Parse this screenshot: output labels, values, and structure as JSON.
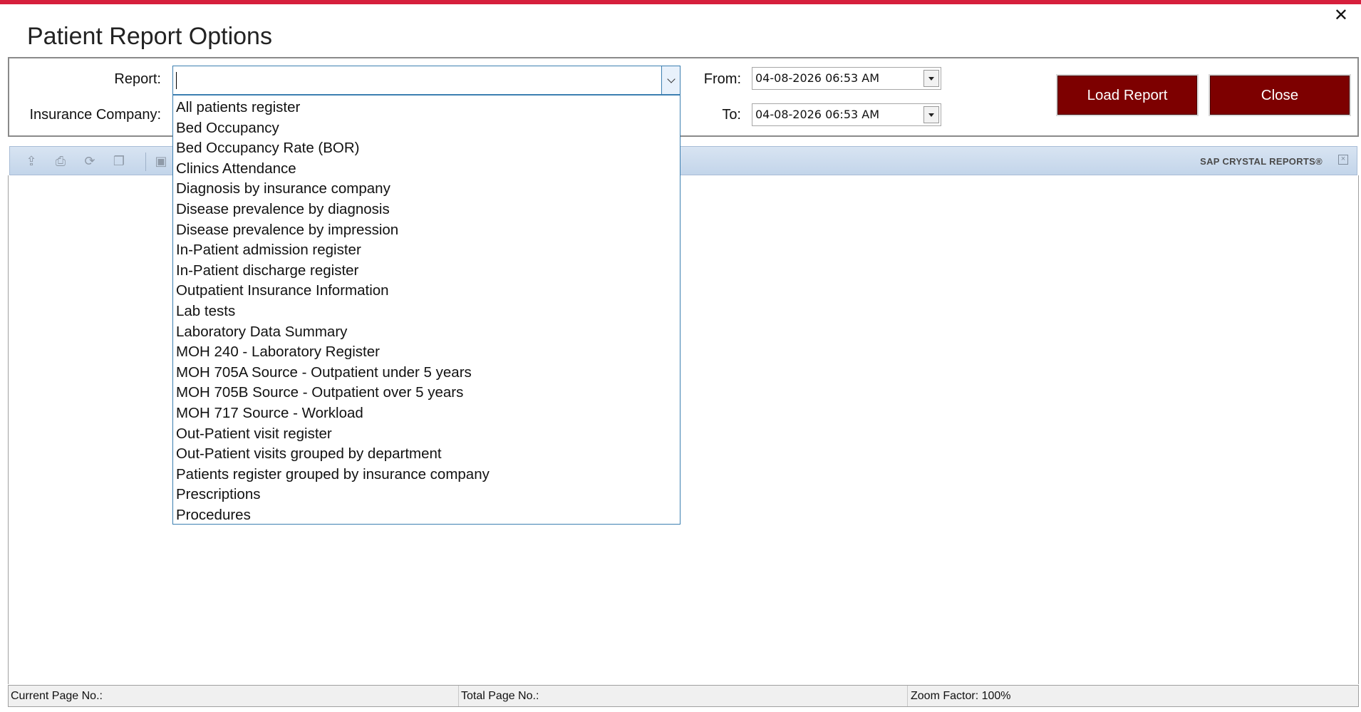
{
  "window": {
    "title": "Patient Report Options",
    "close_symbol": "✕"
  },
  "form": {
    "report_label": "Report:",
    "report_value": "",
    "insurance_label": "Insurance Company:",
    "from_label": "From:",
    "from_value": "04-08-2026  06:53 AM",
    "to_label": "To:",
    "to_value": "04-08-2026  06:53 AM"
  },
  "report_options": [
    "All patients register",
    "Bed Occupancy",
    "Bed Occupancy Rate (BOR)",
    "Clinics Attendance",
    "Diagnosis by insurance company",
    "Disease prevalence by diagnosis",
    "Disease prevalence by impression",
    "In-Patient admission register",
    "In-Patient discharge register",
    "Outpatient Insurance Information",
    "Lab tests",
    "Laboratory Data Summary",
    "MOH 240 - Laboratory Register",
    "MOH 705A Source - Outpatient under 5 years",
    "MOH 705B Source - Outpatient over 5 years",
    "MOH 717 Source - Workload",
    "Out-Patient visit register",
    "Out-Patient visits grouped by department",
    "Patients register grouped by insurance company",
    "Prescriptions",
    "Procedures"
  ],
  "buttons": {
    "load_report": "Load Report",
    "close": "Close"
  },
  "viewer": {
    "brand": "SAP CRYSTAL REPORTS®",
    "toolbar_icons": [
      "export-icon",
      "print-icon",
      "refresh-icon",
      "copy-icon",
      "group-tree-icon"
    ]
  },
  "status": {
    "current_page": "Current Page No.:",
    "total_page": "Total Page No.:",
    "zoom": "Zoom Factor: 100%"
  },
  "colors": {
    "accent": "#d61f3c",
    "button": "#7d0000"
  }
}
